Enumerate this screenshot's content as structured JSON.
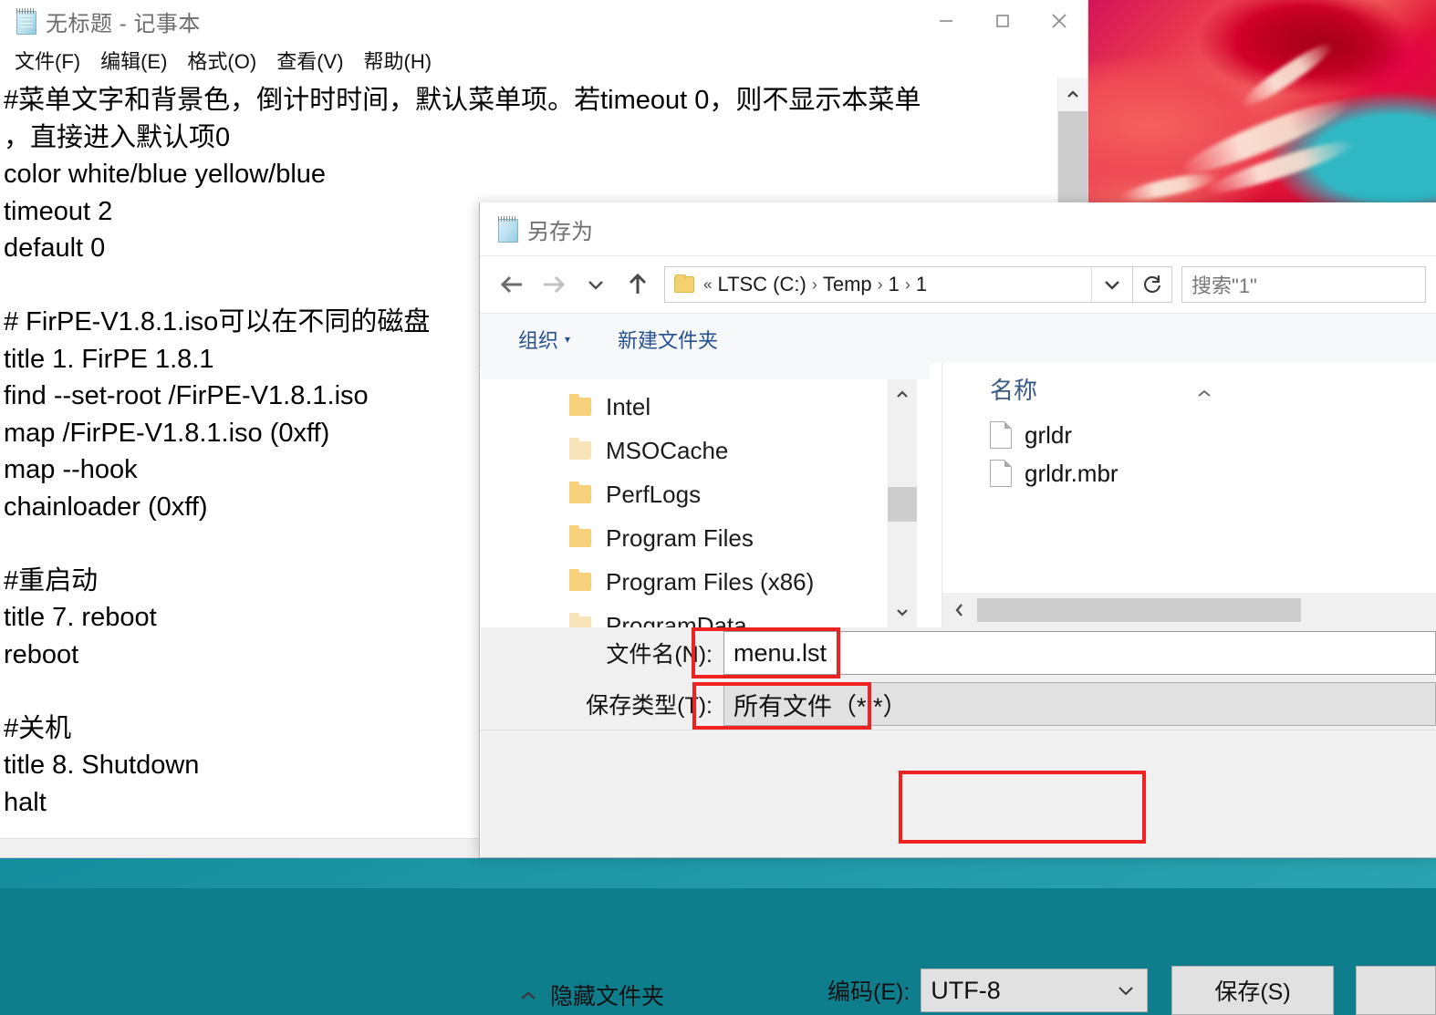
{
  "notepad": {
    "title": "无标题 - 记事本",
    "icon": "notepad-icon",
    "menu": [
      {
        "label": "文件(F)"
      },
      {
        "label": "编辑(E)"
      },
      {
        "label": "格式(O)"
      },
      {
        "label": "查看(V)"
      },
      {
        "label": "帮助(H)"
      }
    ],
    "window_controls": [
      {
        "name": "minimize",
        "glyph": "—"
      },
      {
        "name": "maximize",
        "glyph": "□"
      },
      {
        "name": "close",
        "glyph": "✕"
      }
    ],
    "content": "#菜单文字和背景色，倒计时时间，默认菜单项。若timeout 0，则不显示本菜单\n，直接进入默认项0\ncolor white/blue yellow/blue\ntimeout 2\ndefault 0\n\n# FirPE-V1.8.1.iso可以在不同的磁盘\ntitle 1. FirPE 1.8.1\nfind --set-root /FirPE-V1.8.1.iso\nmap /FirPE-V1.8.1.iso (0xff)\nmap --hook\nchainloader (0xff)\n\n#重启动\ntitle 7. reboot\nreboot\n\n#关机\ntitle 8. Shutdown\nhalt"
  },
  "saveas": {
    "title": "另存为",
    "nav": {
      "back": "←",
      "forward": "→",
      "recent": "⌄",
      "up": "↑"
    },
    "address": {
      "prefix": "«",
      "crumbs": [
        "LTSC (C:)",
        "Temp",
        "1",
        "1"
      ],
      "separator": "›"
    },
    "search": {
      "placeholder": "搜索\"1\"",
      "value": "搜索\"1\""
    },
    "toolbar": {
      "organize": "组织",
      "new_folder": "新建文件夹"
    },
    "navpane": {
      "items": [
        {
          "label": "Intel",
          "dim": false
        },
        {
          "label": "MSOCache",
          "dim": true
        },
        {
          "label": "PerfLogs",
          "dim": false
        },
        {
          "label": "Program Files",
          "dim": false
        },
        {
          "label": "Program Files (x86)",
          "dim": false
        },
        {
          "label": "ProgramData",
          "dim": true
        }
      ]
    },
    "filepane": {
      "column_header": "名称",
      "files": [
        {
          "name": "grldr"
        },
        {
          "name": "grldr.mbr"
        }
      ]
    },
    "form": {
      "filename_label": "文件名(N):",
      "filename_value": "menu.lst",
      "filetype_label": "保存类型(T):",
      "filetype_value": "所有文件（*.*）"
    },
    "footer": {
      "hide_folders": "隐藏文件夹",
      "encoding_label": "编码(E):",
      "encoding_value": "UTF-8",
      "save_label": "保存(S)"
    }
  },
  "colors": {
    "annotation_red": "#ee2222",
    "desktop_teal": "#0d8496",
    "link_blue": "#25518f"
  }
}
